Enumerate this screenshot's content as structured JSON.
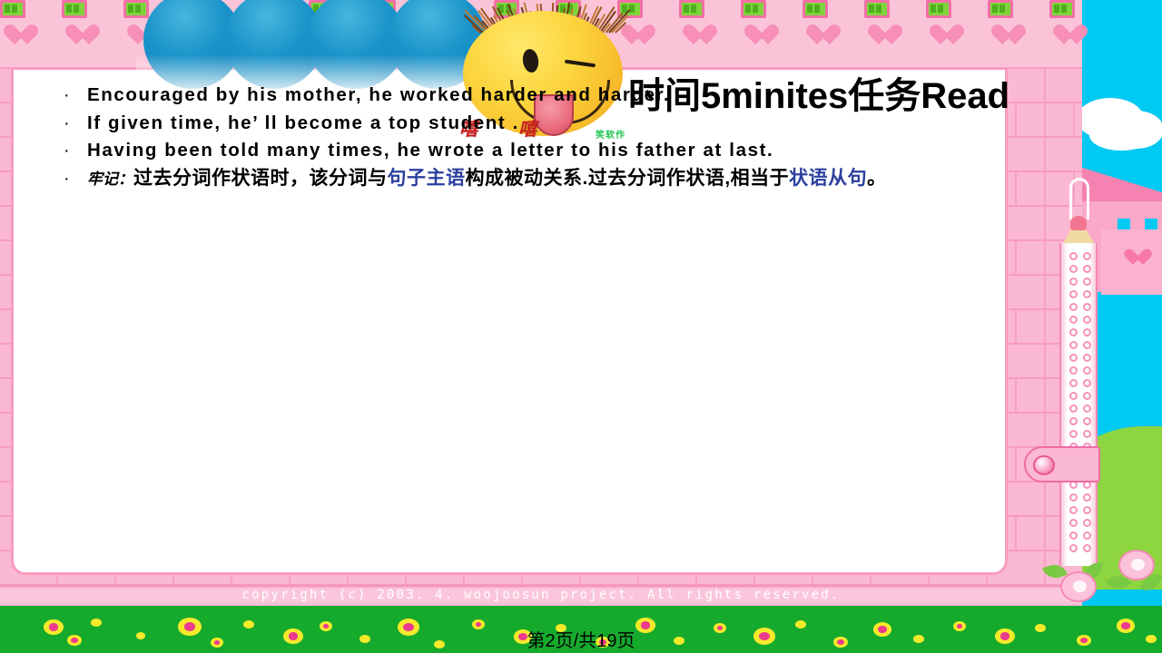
{
  "slide": {
    "big_title": "时间5minites任务Read",
    "bullets": [
      {
        "marker": "·",
        "text": "Encouraged by his mother, he worked harder and harder."
      },
      {
        "marker": "·",
        "text": "If given time, he’ ll become a  top student ."
      },
      {
        "marker": "·",
        "text": "Having been told many times, he wrote a letter to his father at last."
      }
    ],
    "note": {
      "marker": "·",
      "label": "牢记：",
      "part1": "过去分词作状语时，该分词与",
      "highlight1": "句子主语",
      "part2": "构成被动关系.过去分词作状语,相当于",
      "highlight2": "状语从句",
      "part3": "。"
    },
    "sticker_text": "嘻 嘻",
    "watermark_text": "笑软作",
    "copyright": "copyright (c) 2003. 4. woojoosun project. All rights reserved.",
    "page_indicator": "第2页/共19页",
    "colors": {
      "highlight_blue": "#2b3f9e",
      "sticker_red": "#c81d1d",
      "watermark_green": "#21c552",
      "frame_pink": "#f79cc0",
      "sky_cyan": "#00c9f2",
      "grass_green": "#16aa2d",
      "circle_blue": "#1a93c9"
    },
    "decor": {
      "circle_count": 4,
      "emoji_name": "winking-face-tongue-out",
      "icons": [
        "pencil-icon",
        "ruler-icon",
        "heart-icon",
        "flower-icon",
        "cloud-icon",
        "house-icon"
      ]
    }
  }
}
